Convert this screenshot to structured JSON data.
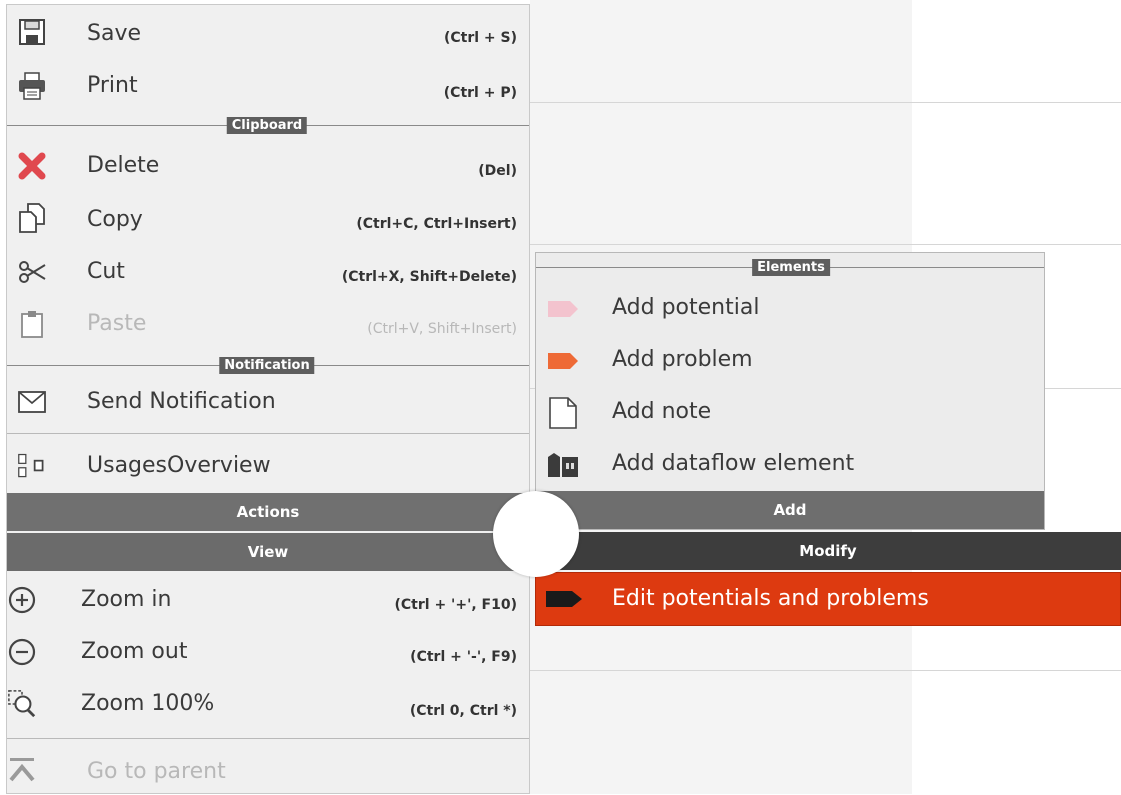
{
  "file_menu": {
    "save": {
      "label": "Save",
      "shortcut": "(Ctrl + S)"
    },
    "print": {
      "label": "Print",
      "shortcut": "(Ctrl + P)"
    }
  },
  "clipboard": {
    "section_title": "Clipboard",
    "delete": {
      "label": "Delete",
      "shortcut": "(Del)"
    },
    "copy": {
      "label": "Copy",
      "shortcut": "(Ctrl+C, Ctrl+Insert)"
    },
    "cut": {
      "label": "Cut",
      "shortcut": "(Ctrl+X, Shift+Delete)"
    },
    "paste": {
      "label": "Paste",
      "shortcut": "(Ctrl+V, Shift+Insert)"
    }
  },
  "notification": {
    "section_title": "Notification",
    "send": {
      "label": "Send Notification"
    }
  },
  "usages": {
    "label": "UsagesOverview"
  },
  "tabs": {
    "actions": "Actions",
    "view": "View",
    "add": "Add",
    "modify": "Modify"
  },
  "view_menu": {
    "zoom_in": {
      "label": "Zoom in",
      "shortcut": "(Ctrl + '+', F10)"
    },
    "zoom_out": {
      "label": "Zoom out",
      "shortcut": "(Ctrl + '-', F9)"
    },
    "zoom_100": {
      "label": "Zoom 100%",
      "shortcut": "(Ctrl 0, Ctrl *)"
    },
    "go_to_parent": {
      "label": "Go to parent"
    }
  },
  "add_menu": {
    "section_title": "Elements",
    "items": [
      {
        "label": "Add potential"
      },
      {
        "label": "Add problem"
      },
      {
        "label": "Add note"
      },
      {
        "label": "Add dataflow element"
      }
    ]
  },
  "modify_menu": {
    "edit": {
      "label": "Edit potentials and problems"
    }
  },
  "icons": {
    "save": "save-icon",
    "print": "print-icon",
    "delete": "delete-icon",
    "copy": "copy-icon",
    "cut": "scissors-icon",
    "paste": "paste-icon",
    "send_notification": "envelope-icon",
    "usages": "documents-icon",
    "zoom_in": "zoom-in-icon",
    "zoom_out": "zoom-out-icon",
    "zoom_100": "zoom-reset-icon",
    "go_to_parent": "go-to-parent-icon",
    "add_potential": "potential-tag-icon",
    "add_problem": "problem-tag-icon",
    "add_note": "note-icon",
    "add_dataflow": "dataflow-icon",
    "edit": "edit-tag-icon"
  },
  "colors": {
    "menu_bg": "#f0f0f0",
    "header_gray": "#6e6e6e",
    "header_dark": "#3d3d3d",
    "highlight": "#dd3a10",
    "problem_orange": "#ee6a36",
    "potential_pink": "#f3c3ce",
    "delete_red": "#e0484e"
  }
}
